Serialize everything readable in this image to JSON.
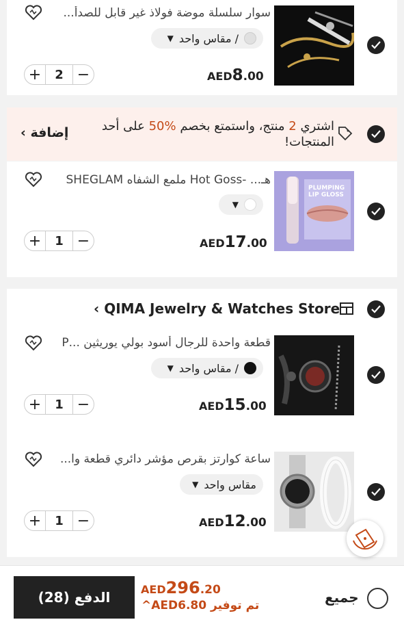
{
  "items_group1": [
    {
      "title": "سوار سلسلة موضة فولاذ غير قابل للصدأ...",
      "spec": "مقاس واحد /",
      "price_currency": "AED",
      "price_main": "8",
      "price_decimal": ".00",
      "quantity": "2"
    }
  ],
  "promo": {
    "text_before": "اشتري ",
    "count": "2",
    "text_middle": " منتج، واستمتع بخصم ",
    "percent": "%50",
    "text_after": " على أحد المنتجات!",
    "link_label": "إضافة"
  },
  "items_group2": [
    {
      "title": "هـ... -Hot Goss ملمع الشفاه SHEGLAM",
      "price_currency": "AED",
      "price_main": "17",
      "price_decimal": ".00",
      "quantity": "1",
      "thumb_text": "PLUMPING LIP GLOSS"
    }
  ],
  "store": {
    "name": "QIMA Jewelry & Watches Store"
  },
  "items_group3": [
    {
      "title": "قطعة واحدة للرجال أسود بولي يوريثين ...P",
      "spec": "مقاس واحد /",
      "price_currency": "AED",
      "price_main": "15",
      "price_decimal": ".00",
      "quantity": "1"
    },
    {
      "title": "ساعة كوارتز بقرص مؤشر دائري قطعة وا...",
      "spec": "مقاس واحد",
      "price_currency": "AED",
      "price_main": "12",
      "price_decimal": ".00",
      "quantity": "1"
    }
  ],
  "bottom": {
    "pay_label": "الدفع (28)",
    "total_currency": "AED",
    "total_main": "296",
    "total_decimal": ".20",
    "saved_label": "تم توفير",
    "saved_amount": "AED6.80",
    "select_all_label": "جميع"
  },
  "colors": {
    "accent": "#c44a17",
    "promo_bg": "#fdf0ec",
    "dark": "#222222"
  }
}
